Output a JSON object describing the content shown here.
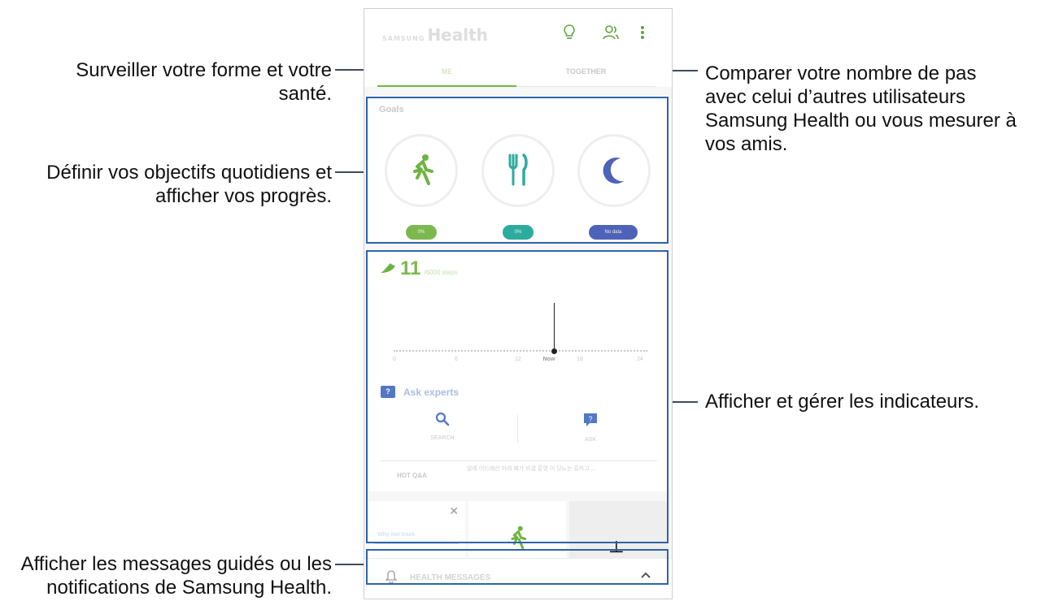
{
  "callouts": {
    "left": [
      {
        "lines": [
          "Surveiller votre forme et votre",
          "santé."
        ]
      },
      {
        "lines": [
          "Définir vos objectifs quotidiens et",
          "afficher vos progrès."
        ]
      },
      {
        "lines": [
          "Afficher les messages guidés ou les",
          "notifications de Samsung Health."
        ]
      }
    ],
    "right": [
      {
        "lines": [
          "Comparer votre nombre de pas",
          "avec celui d’autres utilisateurs",
          "Samsung Health ou vous mesurer à",
          "vos amis."
        ]
      },
      {
        "lines": [
          "Afficher et gérer les indicateurs."
        ]
      }
    ]
  },
  "phone": {
    "logo": {
      "brand": "SAMSUNG",
      "product": "Health"
    },
    "header_icons": [
      "lightbulb-icon",
      "people-icon",
      "more-icon"
    ],
    "tabs": [
      {
        "label": "ME",
        "active": true
      },
      {
        "label": "TOGETHER",
        "active": false
      }
    ],
    "goals": {
      "title": "Goals",
      "items": [
        {
          "icon": "running-icon",
          "glyph": "🏃",
          "status": "0%",
          "color": "#6db342"
        },
        {
          "icon": "fork-knife-icon",
          "glyph": "🍴",
          "status": "0%",
          "color": "#2dab9f"
        },
        {
          "icon": "moon-icon",
          "glyph": "☾",
          "status": "No data",
          "color": "#4e63b8"
        }
      ]
    },
    "steps": {
      "count": "11",
      "target": "/6000 steps",
      "axis_labels": [
        "0",
        "6",
        "12",
        "Now",
        "18",
        "24"
      ]
    },
    "ask_experts": {
      "title": "Ask experts",
      "actions": [
        {
          "label": "SEARCH",
          "icon": "search-icon"
        },
        {
          "label": "ASK",
          "icon": "question-chat-icon"
        }
      ],
      "hot_label": "HOT Q&A",
      "hot_text": "알레 어드레산 아래 째가 비결 흥명 이 당뇨는 흥하고 ..."
    },
    "tips": {
      "first_title": "Why not track"
    },
    "messages": {
      "label": "HEALTH MESSAGES"
    }
  }
}
